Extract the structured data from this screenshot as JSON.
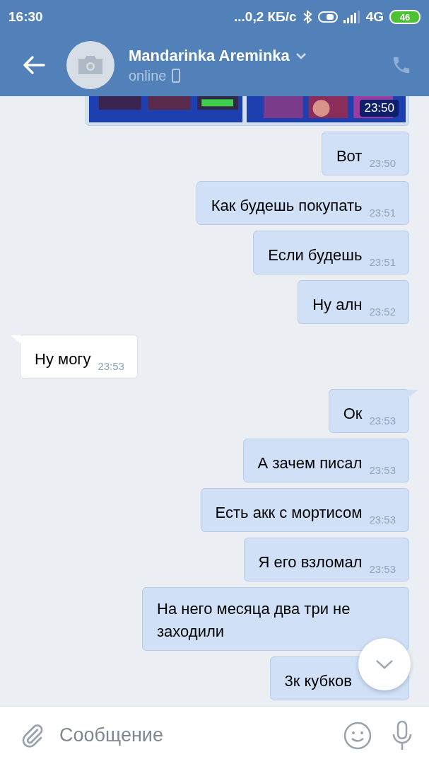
{
  "status_bar": {
    "time": "16:30",
    "speed": "...0,2 КБ/с",
    "network": "4G",
    "battery": "46"
  },
  "header": {
    "name": "Mandarinka Areminka",
    "status": "online"
  },
  "messages": [
    {
      "kind": "picture",
      "outgoing": true,
      "time": "23:50"
    },
    {
      "kind": "text",
      "outgoing": true,
      "tail": false,
      "text": "Вот",
      "time": "23:50"
    },
    {
      "kind": "text",
      "outgoing": true,
      "tail": false,
      "text": "Как будешь покупать",
      "time": "23:51"
    },
    {
      "kind": "text",
      "outgoing": true,
      "tail": false,
      "text": "Если будешь",
      "time": "23:51"
    },
    {
      "kind": "text",
      "outgoing": true,
      "tail": false,
      "text": "Ну алн",
      "time": "23:52"
    },
    {
      "kind": "text",
      "outgoing": false,
      "tail": true,
      "text": "Ну могу",
      "time": "23:53"
    },
    {
      "kind": "text",
      "outgoing": true,
      "tail": true,
      "text": "Ок",
      "time": "23:53"
    },
    {
      "kind": "text",
      "outgoing": true,
      "tail": false,
      "text": "А зачем писал",
      "time": "23:53"
    },
    {
      "kind": "text",
      "outgoing": true,
      "tail": false,
      "text": "Есть акк с мортисом",
      "time": "23:53"
    },
    {
      "kind": "text",
      "outgoing": true,
      "tail": false,
      "text": "Я его взломал",
      "time": "23:53"
    },
    {
      "kind": "text",
      "outgoing": true,
      "tail": false,
      "text": "На него месяца два три не заходили"
    },
    {
      "kind": "text",
      "outgoing": true,
      "tail": false,
      "text": "3к кубков"
    }
  ],
  "composer": {
    "placeholder": "Сообщение"
  }
}
